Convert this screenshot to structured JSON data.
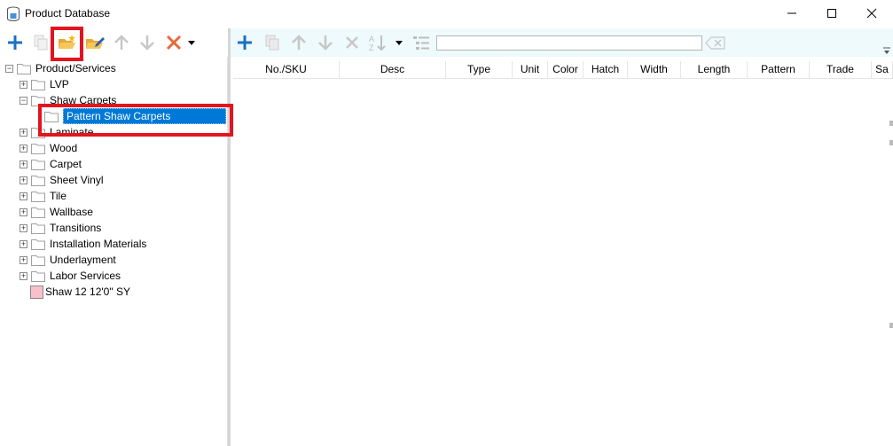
{
  "window": {
    "title": "Product Database"
  },
  "left_toolbar": {
    "buttons": [
      {
        "name": "add",
        "icon": "plus-icon"
      },
      {
        "name": "copy",
        "icon": "copy-icon",
        "disabled": true
      },
      {
        "name": "new-folder",
        "icon": "new-folder-icon",
        "highlighted": true
      },
      {
        "name": "rename-folder",
        "icon": "edit-folder-icon"
      },
      {
        "name": "move-up",
        "icon": "arrow-up-icon",
        "disabled": true
      },
      {
        "name": "move-down",
        "icon": "arrow-down-icon",
        "disabled": true
      },
      {
        "name": "delete",
        "icon": "delete-x-icon"
      },
      {
        "name": "more",
        "icon": "dropdown-caret-icon"
      }
    ]
  },
  "right_toolbar": {
    "search_value": "",
    "buttons": [
      "plus-icon",
      "copy-icon",
      "arrow-up-icon",
      "arrow-down-icon",
      "delete-x-icon",
      "sort-az-icon",
      "dropdown-caret-icon",
      "list-icon",
      "clear-search-icon"
    ]
  },
  "tree": {
    "root": "Product/Services",
    "items": [
      {
        "label": "LVP",
        "expander": "+"
      },
      {
        "label": "Shaw Carpets",
        "expander": "-"
      },
      {
        "label": "Pattern Shaw Carpets",
        "selected": true
      },
      {
        "label": "Laminate",
        "expander": "+"
      },
      {
        "label": "Wood",
        "expander": "+"
      },
      {
        "label": "Carpet",
        "expander": "+"
      },
      {
        "label": "Sheet Vinyl",
        "expander": "+"
      },
      {
        "label": "Tile",
        "expander": "+"
      },
      {
        "label": "Wallbase",
        "expander": "+"
      },
      {
        "label": "Transitions",
        "expander": "+"
      },
      {
        "label": "Installation Materials",
        "expander": "+"
      },
      {
        "label": "Underlayment",
        "expander": "+"
      },
      {
        "label": "Labor Services",
        "expander": "+"
      },
      {
        "label": "Shaw 12 12'0\" SY",
        "swatch_color": "#f8c0cb"
      }
    ]
  },
  "grid": {
    "columns": [
      "No./SKU",
      "Desc",
      "Type",
      "Unit",
      "Color",
      "Hatch",
      "Width",
      "Length",
      "Pattern",
      "Trade",
      "Sa"
    ],
    "rows": []
  },
  "colors": {
    "accent_blue": "#0078d7",
    "highlight_red": "#e3141f",
    "toolbar_bg": "#eefafc"
  }
}
